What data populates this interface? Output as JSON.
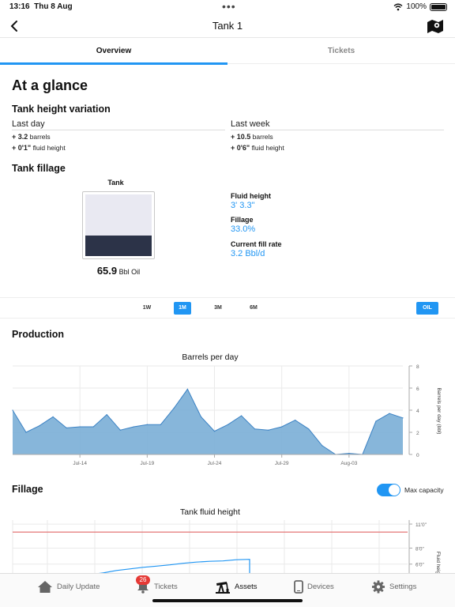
{
  "status": {
    "time": "13:16",
    "date": "Thu 8 Aug",
    "battery": "100%"
  },
  "nav": {
    "title": "Tank 1"
  },
  "tabs": [
    {
      "label": "Overview",
      "active": true
    },
    {
      "label": "Tickets",
      "active": false
    }
  ],
  "glance": {
    "heading": "At a glance",
    "variation_heading": "Tank height variation",
    "last_day": {
      "label": "Last day",
      "barrels_val": "+ 3.2",
      "barrels_unit": "barrels",
      "height_val": "+ 0'1\"",
      "height_unit": "fluid height"
    },
    "last_week": {
      "label": "Last week",
      "barrels_val": "+ 10.5",
      "barrels_unit": "barrels",
      "height_val": "+ 0'6\"",
      "height_unit": "fluid height"
    }
  },
  "fillage_section": {
    "heading": "Tank fillage",
    "tank_label": "Tank",
    "volume": "65.9",
    "volume_unit": "Bbl Oil",
    "fill_fraction": 0.33,
    "fluid_height_label": "Fluid height",
    "fluid_height_value": "3' 3.3\"",
    "fillage_label": "Fillage",
    "fillage_value": "33.0%",
    "fill_rate_label": "Current fill rate",
    "fill_rate_value": "3.2 Bbl/d"
  },
  "ranges": {
    "options": [
      "1W",
      "1M",
      "3M",
      "6M"
    ],
    "selected": "1M",
    "product": "OIL"
  },
  "production": {
    "heading": "Production"
  },
  "fillage_chart_section": {
    "heading": "Fillage",
    "toggle_label": "Max capacity",
    "toggle_on": true
  },
  "colors": {
    "accent": "#2196f3",
    "area": "#7aaed6",
    "area_line": "#3b82c4",
    "max_line": "#e06666"
  },
  "chart_data": [
    {
      "type": "area",
      "title": "Barrels per day",
      "ylabel": "Barrels per day (bbl)",
      "ylim": [
        0,
        8
      ],
      "yticks": [
        "0",
        "2",
        "4",
        "6",
        "8"
      ],
      "xticks": [
        "Jul-14",
        "Jul-19",
        "Jul-24",
        "Jul-29",
        "Aug-03"
      ],
      "x": [
        "Jul-09",
        "Jul-10",
        "Jul-11",
        "Jul-12",
        "Jul-13",
        "Jul-14",
        "Jul-15",
        "Jul-16",
        "Jul-17",
        "Jul-18",
        "Jul-19",
        "Jul-20",
        "Jul-21",
        "Jul-22",
        "Jul-23",
        "Jul-24",
        "Jul-25",
        "Jul-26",
        "Jul-27",
        "Jul-28",
        "Jul-29",
        "Jul-30",
        "Jul-31",
        "Aug-01",
        "Aug-02",
        "Aug-03",
        "Aug-04",
        "Aug-05",
        "Aug-06",
        "Aug-07"
      ],
      "values": [
        4.0,
        2.0,
        2.6,
        3.4,
        2.4,
        2.5,
        2.5,
        3.6,
        2.2,
        2.5,
        2.7,
        2.7,
        4.2,
        5.9,
        3.4,
        2.1,
        2.7,
        3.5,
        2.3,
        2.2,
        2.5,
        3.1,
        2.3,
        0.8,
        0.0,
        0.1,
        0.0,
        3.0,
        3.7,
        3.3
      ],
      "grid": true
    },
    {
      "type": "line",
      "title": "Tank fluid height",
      "ylabel": "Fluid heig",
      "yticks": [
        "6'0\"",
        "8'0\"",
        "11'0\""
      ],
      "ylim": [
        4,
        11.5
      ],
      "max_capacity": 10.0,
      "values": [
        4.35,
        4.5,
        4.7,
        4.9,
        5.2,
        5.4,
        5.6,
        5.75,
        5.9,
        6.1,
        6.25,
        6.35,
        6.4,
        6.55,
        6.6
      ]
    }
  ],
  "bottom_nav": [
    {
      "label": "Daily Update",
      "active": false
    },
    {
      "label": "Tickets",
      "active": false,
      "badge": "26"
    },
    {
      "label": "Assets",
      "active": true
    },
    {
      "label": "Devices",
      "active": false
    },
    {
      "label": "Settings",
      "active": false
    }
  ]
}
